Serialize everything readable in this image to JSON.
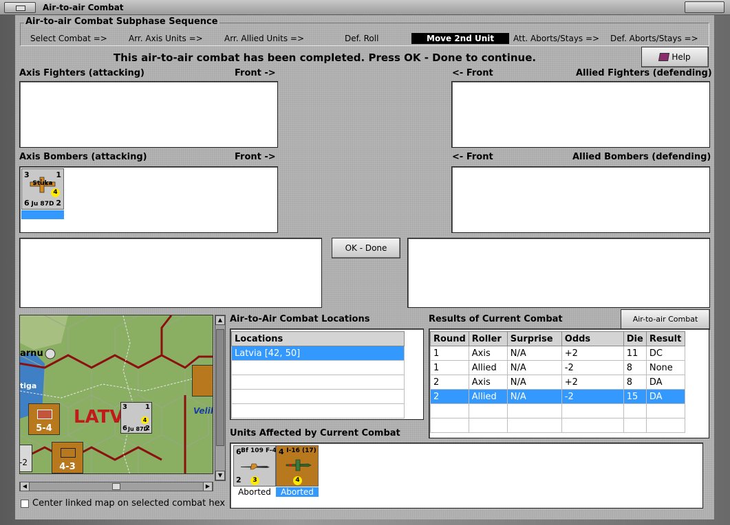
{
  "window": {
    "title": "Air-to-air Combat",
    "close_label": ""
  },
  "sequence": {
    "title": "Air-to-air Combat Subphase Sequence",
    "steps": [
      "Select Combat =>",
      "Arr. Axis Units =>",
      "Arr. Allied Units =>",
      "Def. Roll",
      "Move 2nd Unit",
      "Att. Aborts/Stays =>",
      "Def. Aborts/Stays =>"
    ],
    "active_step": "Move 2nd Unit"
  },
  "status_message": "This air-to-air combat has been completed.  Press OK - Done to continue.",
  "help_button": "Help",
  "sections": {
    "axis_fighters": "Axis Fighters (attacking)",
    "axis_fighters_front": "Front ->",
    "allied_fighters_front": "<- Front",
    "allied_fighters": "Allied Fighters (defending)",
    "axis_bombers": "Axis Bombers (attacking)",
    "axis_bombers_front": "Front ->",
    "allied_bombers_front": "<- Front",
    "allied_bombers": "Allied Bombers (defending)"
  },
  "axis_bomber_unit": {
    "name": "Ju 87D",
    "top_left": "3",
    "top_right": "1",
    "bottom_left": "6",
    "bottom_right": "2",
    "circle": "4",
    "subtitle": "Stuka"
  },
  "ok_button": "OK - Done",
  "map": {
    "labels": [
      "arnu",
      "tiga",
      "LATV",
      "Velik"
    ],
    "counters": [
      {
        "value": "5-4",
        "tag": "XXX"
      },
      {
        "value": "4-3",
        "tag": "XXXX"
      },
      {
        "value": "-2",
        "tag": ""
      }
    ],
    "stuka_counter": {
      "name": "Ju 87D",
      "top_left": "3",
      "top_right": "1",
      "bottom_left": "6",
      "bottom_right": "2",
      "circle": "4"
    }
  },
  "center_map_checkbox": "Center linked map on selected combat hex",
  "locations": {
    "title": "Air-to-Air Combat Locations",
    "header": "Locations",
    "rows": [
      "Latvia [42, 50]",
      "",
      "",
      "",
      ""
    ]
  },
  "results": {
    "title": "Results of Current Combat",
    "chart_button": "Air-to-air Combat Chart",
    "columns": [
      "Round",
      "Roller",
      "Surprise",
      "Odds",
      "Die",
      "Result"
    ],
    "rows": [
      [
        "1",
        "Axis",
        "N/A",
        "+2",
        "11",
        "DC"
      ],
      [
        "1",
        "Allied",
        "N/A",
        "-2",
        "8",
        "None"
      ],
      [
        "2",
        "Axis",
        "N/A",
        "+2",
        "8",
        "DA"
      ],
      [
        "2",
        "Allied",
        "N/A",
        "-2",
        "15",
        "DA"
      ],
      [
        "",
        "",
        "",
        "",
        "",
        ""
      ],
      [
        "",
        "",
        "",
        "",
        "",
        ""
      ]
    ],
    "selected_row": 3
  },
  "affected": {
    "title": "Units Affected by Current Combat",
    "units": [
      {
        "name": "Bf 109 F-4",
        "top_left": "6",
        "bottom_left": "2",
        "circle": "3",
        "status": "Aborted",
        "color": "#c8c8c8"
      },
      {
        "name": "I-16 (17)",
        "top_left": "4",
        "bottom_left": "",
        "circle": "4",
        "status": "Aborted",
        "color": "#b8781e"
      }
    ]
  },
  "colors": {
    "selection": "#3399ff",
    "allied_unit": "#b8781e",
    "axis_unit": "#c8c8c8"
  }
}
